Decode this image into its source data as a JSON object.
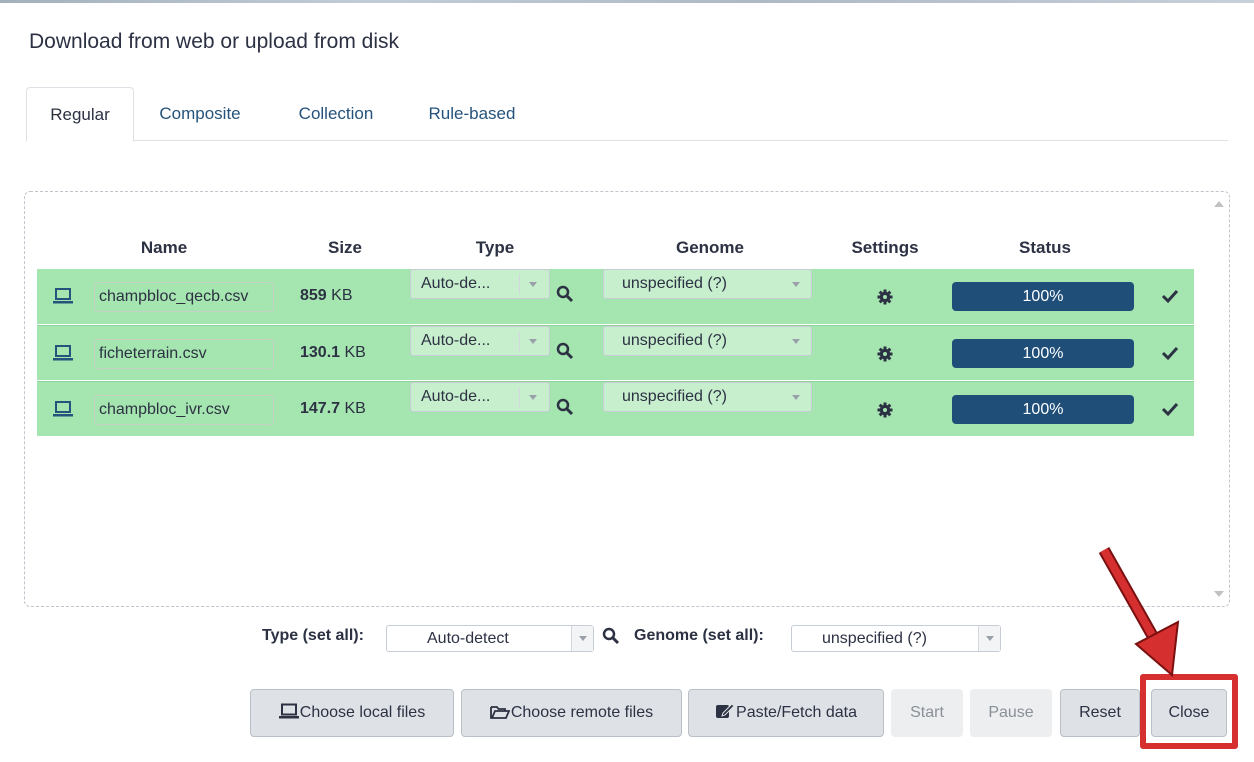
{
  "modal": {
    "title": "Download from web or upload from disk"
  },
  "tabs": [
    {
      "label": "Regular",
      "active": true
    },
    {
      "label": "Composite",
      "active": false
    },
    {
      "label": "Collection",
      "active": false
    },
    {
      "label": "Rule-based",
      "active": false
    }
  ],
  "table": {
    "headers": {
      "name": "Name",
      "size": "Size",
      "type": "Type",
      "genome": "Genome",
      "settings": "Settings",
      "status": "Status"
    },
    "rows": [
      {
        "name": "champbloc_qecb.csv",
        "size_value": "859",
        "size_unit": " KB",
        "type": "Auto-de...",
        "genome": "unspecified (?)",
        "status": "100%",
        "progress": 100
      },
      {
        "name": "ficheterrain.csv",
        "size_value": "130.1",
        "size_unit": " KB",
        "type": "Auto-de...",
        "genome": "unspecified (?)",
        "status": "100%",
        "progress": 100
      },
      {
        "name": "champbloc_ivr.csv",
        "size_value": "147.7",
        "size_unit": " KB",
        "type": "Auto-de...",
        "genome": "unspecified (?)",
        "status": "100%",
        "progress": 100
      }
    ]
  },
  "set_all": {
    "type_label": "Type (set all):",
    "type_value": "Auto-detect",
    "genome_label": "Genome (set all):",
    "genome_value": "unspecified (?)"
  },
  "buttons": {
    "choose_local": "Choose local files",
    "choose_remote": "Choose remote files",
    "paste_fetch": "Paste/Fetch data",
    "start": "Start",
    "pause": "Pause",
    "reset": "Reset",
    "close": "Close"
  },
  "colors": {
    "row_success": "#a5e5af",
    "progress_bar": "#1f4e79",
    "tab_link": "#25537b",
    "annotation_red": "#d62f2f"
  },
  "icons": [
    "laptop-icon",
    "search-icon",
    "gear-icon",
    "check-icon",
    "folder-open-icon",
    "edit-icon"
  ]
}
